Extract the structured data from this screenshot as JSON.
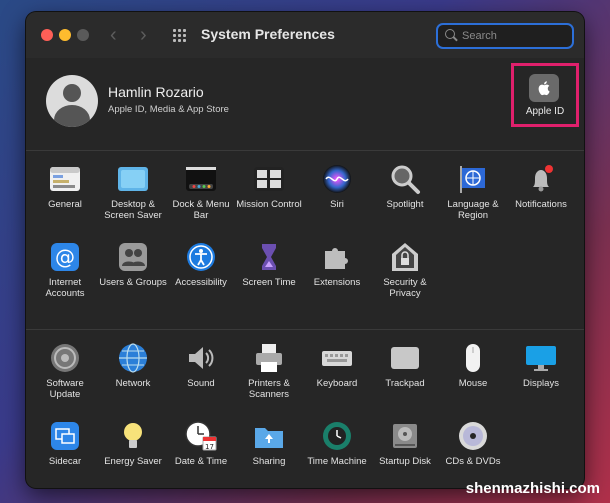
{
  "window": {
    "title": "System Preferences",
    "search_placeholder": "Search"
  },
  "account": {
    "name": "Hamlin Rozario",
    "subtitle": "Apple ID, Media & App Store",
    "apple_id_label": "Apple ID"
  },
  "section1": [
    {
      "label": "General",
      "icon": "general-icon"
    },
    {
      "label": "Desktop & Screen Saver",
      "icon": "desktop-screen-saver-icon"
    },
    {
      "label": "Dock & Menu Bar",
      "icon": "dock-menu-bar-icon"
    },
    {
      "label": "Mission Control",
      "icon": "mission-control-icon"
    },
    {
      "label": "Siri",
      "icon": "siri-icon"
    },
    {
      "label": "Spotlight",
      "icon": "spotlight-icon"
    },
    {
      "label": "Language & Region",
      "icon": "language-region-icon"
    },
    {
      "label": "Notifications",
      "icon": "notifications-icon"
    },
    {
      "label": "Internet Accounts",
      "icon": "internet-accounts-icon"
    },
    {
      "label": "Users & Groups",
      "icon": "users-groups-icon"
    },
    {
      "label": "Accessibility",
      "icon": "accessibility-icon"
    },
    {
      "label": "Screen Time",
      "icon": "screen-time-icon"
    },
    {
      "label": "Extensions",
      "icon": "extensions-icon"
    },
    {
      "label": "Security & Privacy",
      "icon": "security-privacy-icon"
    }
  ],
  "section2": [
    {
      "label": "Software Update",
      "icon": "software-update-icon"
    },
    {
      "label": "Network",
      "icon": "network-icon"
    },
    {
      "label": "Sound",
      "icon": "sound-icon"
    },
    {
      "label": "Printers & Scanners",
      "icon": "printers-scanners-icon"
    },
    {
      "label": "Keyboard",
      "icon": "keyboard-icon"
    },
    {
      "label": "Trackpad",
      "icon": "trackpad-icon"
    },
    {
      "label": "Mouse",
      "icon": "mouse-icon"
    },
    {
      "label": "Displays",
      "icon": "displays-icon"
    },
    {
      "label": "Sidecar",
      "icon": "sidecar-icon"
    },
    {
      "label": "Energy Saver",
      "icon": "energy-saver-icon"
    },
    {
      "label": "Date & Time",
      "icon": "date-time-icon"
    },
    {
      "label": "Sharing",
      "icon": "sharing-icon"
    },
    {
      "label": "Time Machine",
      "icon": "time-machine-icon"
    },
    {
      "label": "Startup Disk",
      "icon": "startup-disk-icon"
    },
    {
      "label": "CDs & DVDs",
      "icon": "cds-dvds-icon"
    }
  ],
  "date_icon_day": "17",
  "watermark": "shenmazhishi.com"
}
